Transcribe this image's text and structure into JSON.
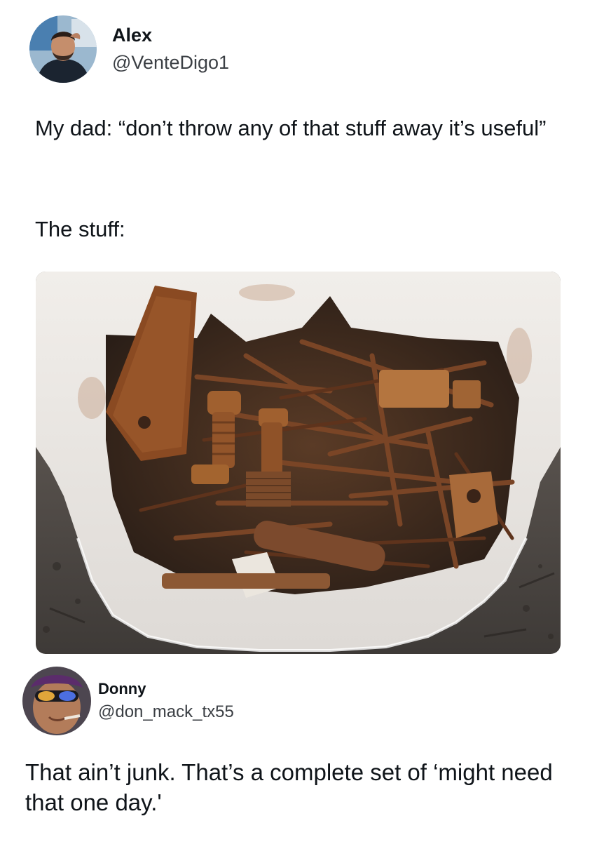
{
  "post1": {
    "author": {
      "display_name": "Alex",
      "handle": "@VenteDigo1"
    },
    "text_line1": "My dad: “don’t throw any of that stuff away it’s useful”",
    "text_line2": "The stuff:",
    "image_subject": "cut-open white plastic container filled with rusty nails, bolts, nuts and scrap metal"
  },
  "post2": {
    "author": {
      "display_name": "Donny",
      "handle": "@don_mack_tx55"
    },
    "text": "That ain’t junk. That’s a complete set of ‘might need that one day.'"
  },
  "colors": {
    "text": "#0f1419",
    "handle": "#3b3f44",
    "background": "#ffffff",
    "rust": "#8a4a22"
  }
}
